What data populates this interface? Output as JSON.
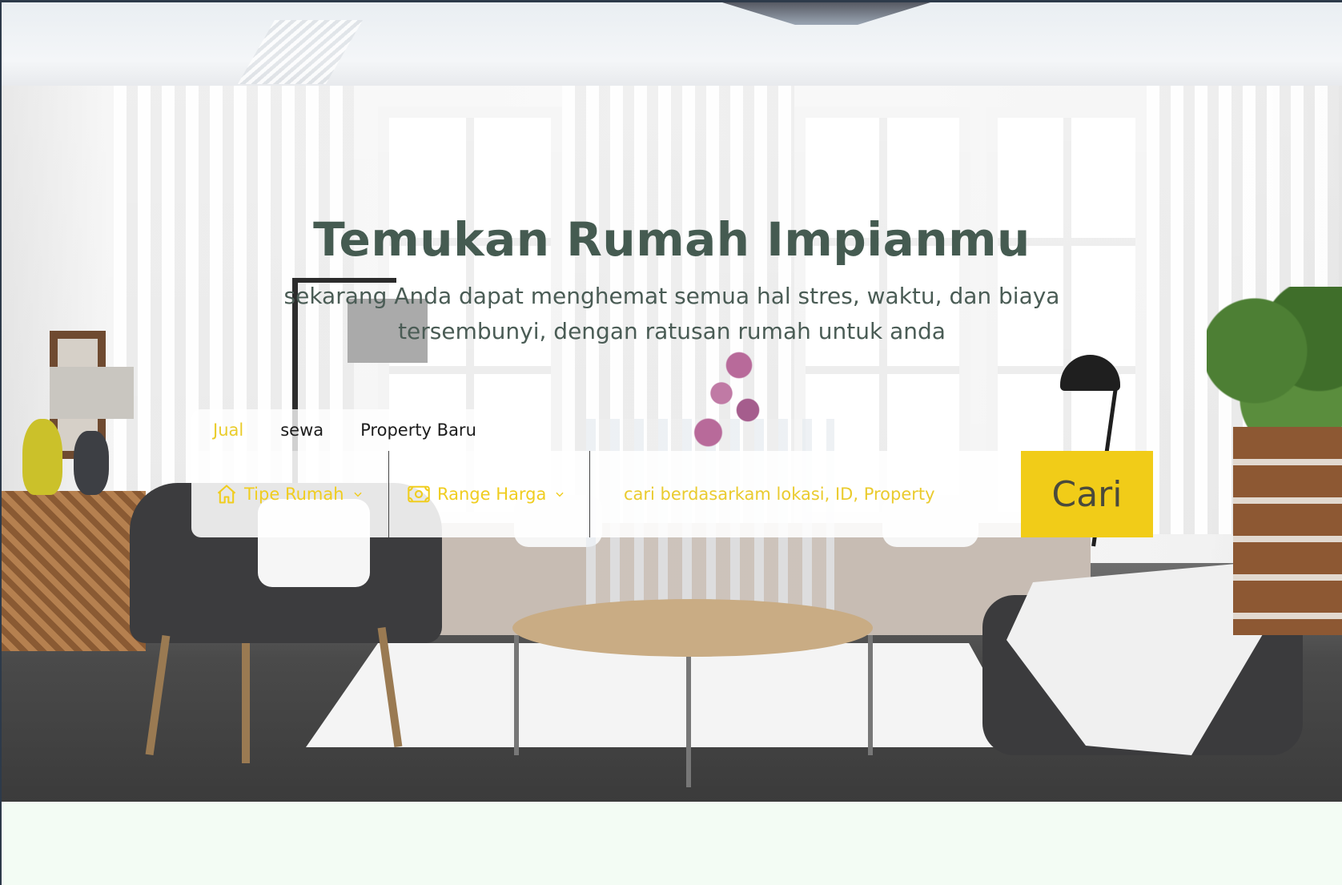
{
  "hero": {
    "title": "Temukan Rumah Impianmu",
    "subtitle": "sekarang Anda dapat menghemat semua hal stres, waktu, dan biaya tersembunyi, dengan ratusan rumah untuk anda"
  },
  "search": {
    "tabs": [
      {
        "label": "Jual",
        "active": true
      },
      {
        "label": "sewa",
        "active": false
      },
      {
        "label": "Property Baru",
        "active": false
      }
    ],
    "house_type": {
      "label": "Tipe Rumah",
      "icon": "home-icon"
    },
    "price_range": {
      "label": "Range Harga",
      "icon": "money-icon"
    },
    "placeholder": "cari berdasarkam lokasi, ID, Property",
    "button_label": "Cari"
  },
  "colors": {
    "accent": "#f1cc18",
    "heading": "#455b51",
    "below_hero_background": "#f3fcf4"
  }
}
